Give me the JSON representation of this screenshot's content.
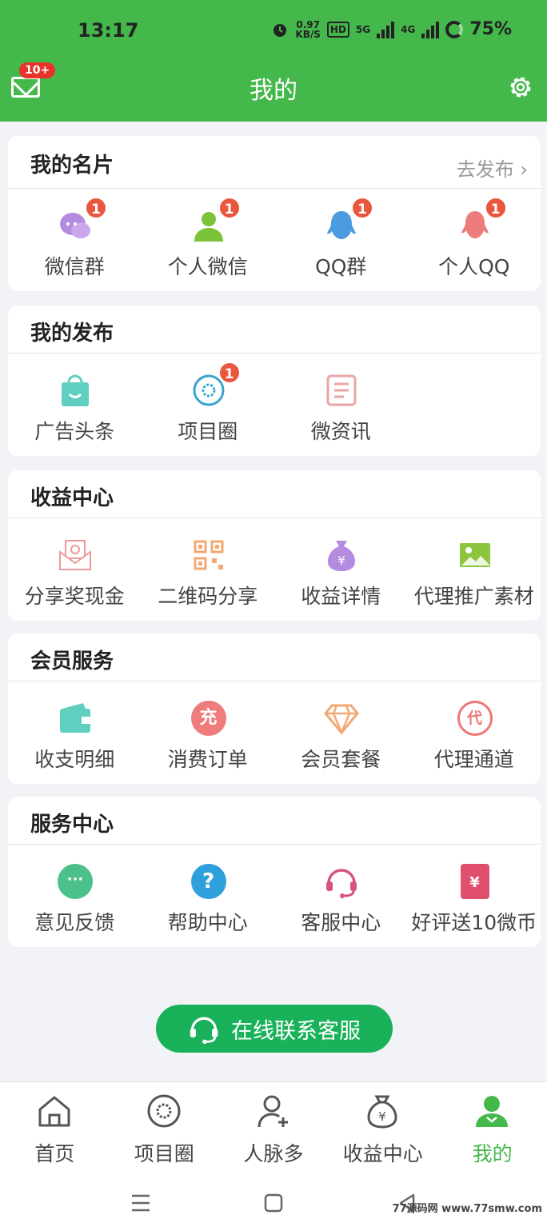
{
  "status": {
    "time": "13:17",
    "net_speed": "0.97",
    "net_unit": "KB/S",
    "hd": "HD",
    "sig1": "5G",
    "sig2": "4G",
    "battery": "75%"
  },
  "header": {
    "title": "我的",
    "mail_badge": "10+"
  },
  "cards": {
    "card": {
      "title": "我的名片",
      "link": "去发布 ›",
      "items": [
        {
          "label": "微信群",
          "badge": "1"
        },
        {
          "label": "个人微信",
          "badge": "1"
        },
        {
          "label": "QQ群",
          "badge": "1"
        },
        {
          "label": "个人QQ",
          "badge": "1"
        }
      ]
    },
    "publish": {
      "title": "我的发布",
      "items": [
        {
          "label": "广告头条"
        },
        {
          "label": "项目圈",
          "badge": "1"
        },
        {
          "label": "微资讯"
        }
      ]
    },
    "income": {
      "title": "收益中心",
      "items": [
        {
          "label": "分享奖现金"
        },
        {
          "label": "二维码分享"
        },
        {
          "label": "收益详情"
        },
        {
          "label": "代理推广素材"
        }
      ]
    },
    "member": {
      "title": "会员服务",
      "items": [
        {
          "label": "收支明细"
        },
        {
          "label": "消费订单",
          "icon_text": "充"
        },
        {
          "label": "会员套餐"
        },
        {
          "label": "代理通道",
          "icon_text": "代"
        }
      ]
    },
    "service": {
      "title": "服务中心",
      "items": [
        {
          "label": "意见反馈",
          "icon_text": "···"
        },
        {
          "label": "帮助中心",
          "icon_text": "?"
        },
        {
          "label": "客服中心"
        },
        {
          "label": "好评送10微币",
          "icon_text": "¥"
        }
      ]
    }
  },
  "contact_button": "在线联系客服",
  "tabs": [
    {
      "label": "首页"
    },
    {
      "label": "项目圈"
    },
    {
      "label": "人脉多"
    },
    {
      "label": "收益中心"
    },
    {
      "label": "我的"
    }
  ],
  "watermark": "77源码网 www.77smw.com",
  "colors": {
    "primary": "#45b84c",
    "button": "#19b25a",
    "badge": "#e9573f"
  }
}
